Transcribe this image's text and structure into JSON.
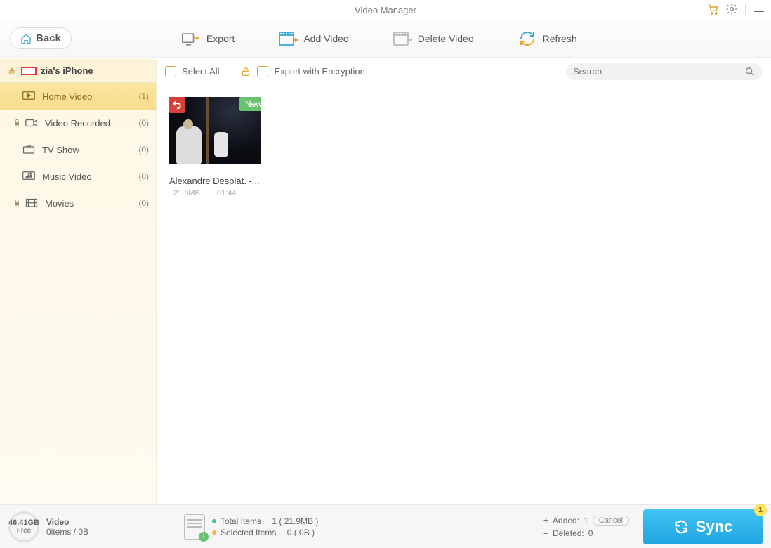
{
  "window": {
    "title": "Video Manager"
  },
  "toolbar": {
    "back": "Back",
    "export": "Export",
    "add_video": "Add Video",
    "delete_video": "Delete Video",
    "refresh": "Refresh"
  },
  "subheader": {
    "select_all": "Select All",
    "export_encryption": "Export with Encryption",
    "search_placeholder": "Search"
  },
  "device": {
    "name": "zia's iPhone"
  },
  "sidebar": {
    "items": [
      {
        "label": "Home Video",
        "count": "(1)"
      },
      {
        "label": "Video Recorded",
        "count": "(0)"
      },
      {
        "label": "TV Show",
        "count": "(0)"
      },
      {
        "label": "Music Video",
        "count": "(0)"
      },
      {
        "label": "Movies",
        "count": "(0)"
      }
    ]
  },
  "grid": {
    "items": [
      {
        "title": "Alexandre Desplat. -...",
        "size": "21.9MB",
        "duration": "01:44",
        "badge": "New"
      }
    ]
  },
  "footer": {
    "disk_size": "46.41GB",
    "disk_free": "Free",
    "section": "Video",
    "section_sub": "0items / 0B",
    "total_label": "Total Items",
    "total_value": "1  ( 21.9MB )",
    "selected_label": "Selected Items",
    "selected_value": "0  ( 0B )",
    "added_label": "Added:",
    "added_value": "1",
    "cancel": "Cancel",
    "deleted_label": "Deleted:",
    "deleted_value": "0",
    "sync": "Sync",
    "sync_badge": "1"
  }
}
